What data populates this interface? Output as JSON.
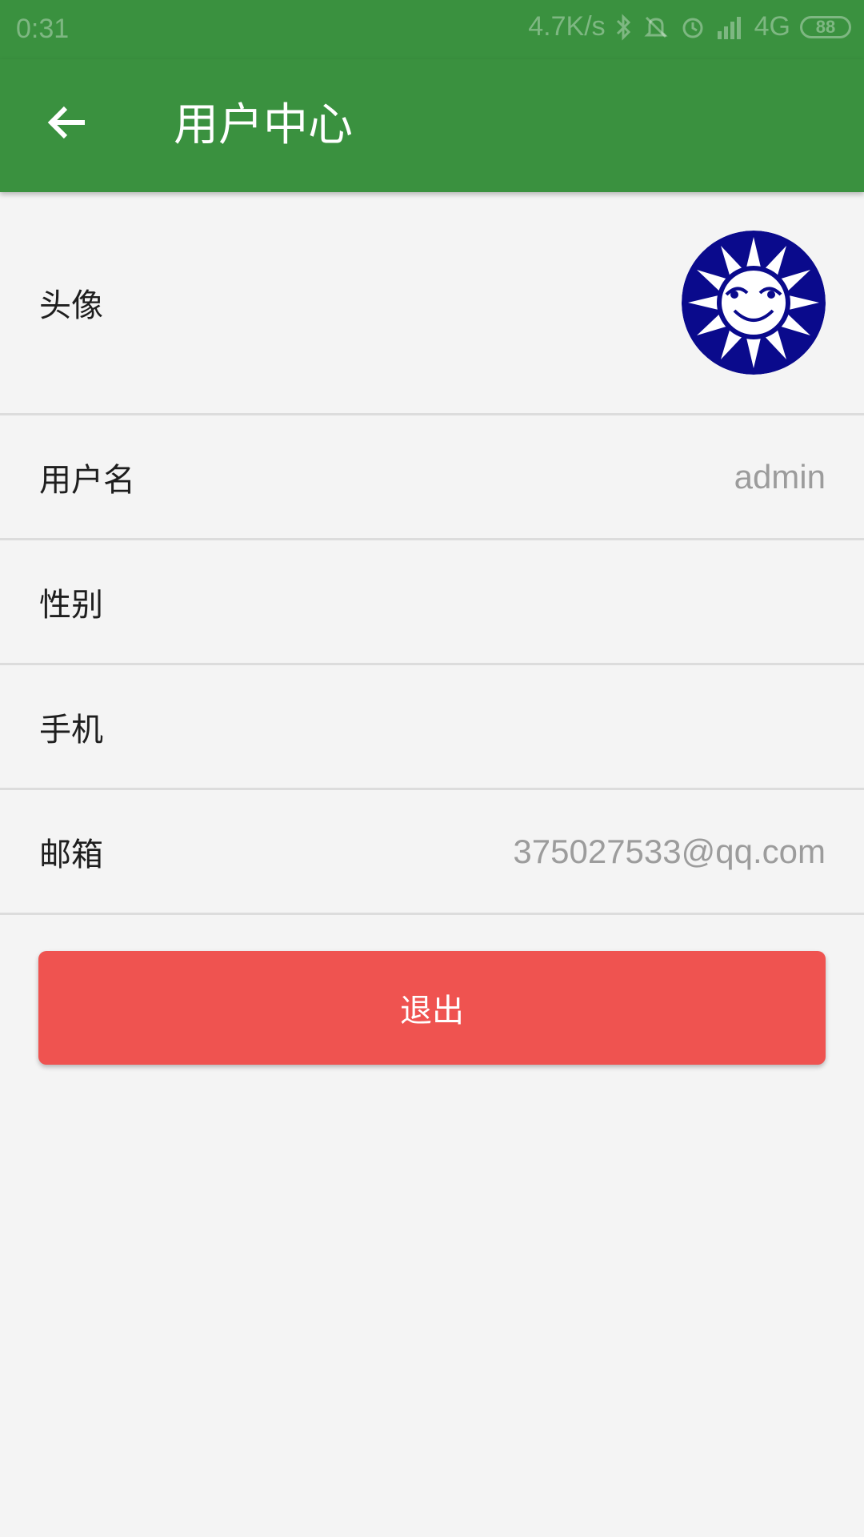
{
  "status_bar": {
    "time": "0:31",
    "net_speed": "4.7K/s",
    "network_type": "4G",
    "battery": "88",
    "icons": [
      "bluetooth-icon",
      "mute-icon",
      "alarm-icon",
      "signal-icon",
      "battery-icon"
    ]
  },
  "app_bar": {
    "title": "用户中心",
    "back_icon": "arrow-left-icon"
  },
  "rows": {
    "avatar": {
      "label": "头像"
    },
    "username": {
      "label": "用户名",
      "value": "admin"
    },
    "gender": {
      "label": "性别",
      "value": ""
    },
    "phone": {
      "label": "手机",
      "value": ""
    },
    "email": {
      "label": "邮箱",
      "value": "375027533@qq.com"
    }
  },
  "logout_button": {
    "label": "退出"
  },
  "colors": {
    "primary": "#3a913f",
    "logout": "#ef5350",
    "avatar_bg": "#0a0a8c"
  }
}
